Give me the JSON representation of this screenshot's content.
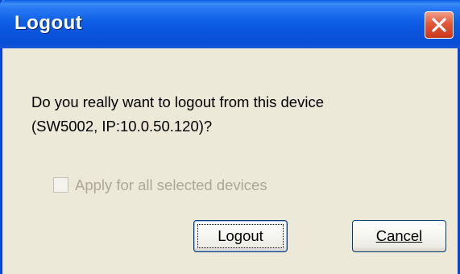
{
  "window": {
    "title": "Logout"
  },
  "message": {
    "line1": "Do you really want to logout from this device",
    "line2": "(SW5002, IP:10.0.50.120)?"
  },
  "checkbox": {
    "label": "Apply for all selected devices",
    "checked": false,
    "disabled": true
  },
  "buttons": {
    "logout_label": "Logout",
    "cancel_label": "Cancel"
  },
  "icons": {
    "close": "close-icon"
  },
  "colors": {
    "titlebar": "#0a53db",
    "close_button": "#e2573a",
    "dialog_background": "#ece9d8",
    "disabled_text": "#aca899"
  }
}
